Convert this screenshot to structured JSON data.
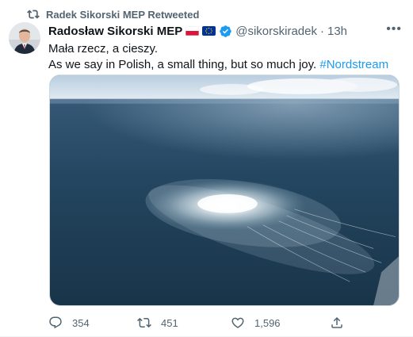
{
  "retweet_banner": {
    "text": "Radek Sikorski MEP Retweeted",
    "icon": "retweet-icon"
  },
  "author": {
    "name": "Radosław Sikorski MEP",
    "handle": "@sikorskiradek",
    "separator": "·",
    "time": "13h",
    "flags": [
      "poland-flag-icon",
      "eu-flag-icon"
    ],
    "verified_color": "#1d9bf0"
  },
  "tweet": {
    "line1": "Mała rzecz, a cieszy.",
    "line2": "As we say in Polish, a small thing, but so much joy.",
    "hashtag": "#Nordstream"
  },
  "media": {
    "description_icon": "sea-photo"
  },
  "actions": {
    "replies": "354",
    "retweets": "451",
    "likes": "1,596"
  },
  "colors": {
    "accent": "#1d9bf0",
    "muted": "#536471",
    "text": "#0f1419"
  }
}
